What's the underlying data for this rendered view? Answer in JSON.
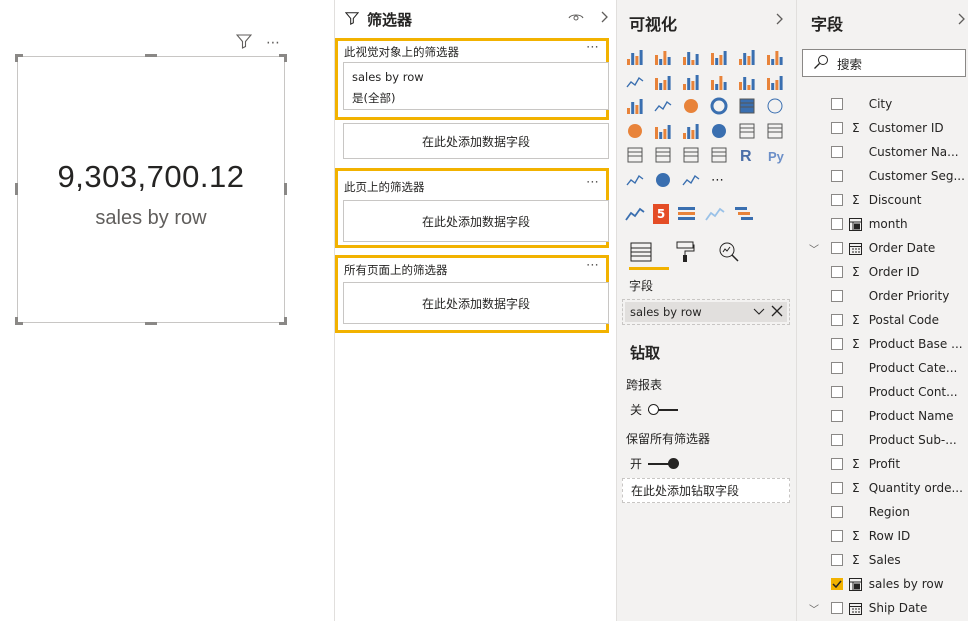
{
  "card": {
    "value": "9,303,700.12",
    "label": "sales by row",
    "more": "⋯"
  },
  "filters": {
    "title": "筛选器",
    "visual_title": "此视觉对象上的筛选器",
    "visual_field": "sales by row",
    "visual_condition": "是(全部)",
    "visual_add": "在此处添加数据字段",
    "page_title": "此页上的筛选器",
    "page_add": "在此处添加数据字段",
    "all_title": "所有页面上的筛选器",
    "all_add": "在此处添加数据字段",
    "more": "⋯"
  },
  "viz": {
    "title": "可视化",
    "fields_label": "字段",
    "field_value": "sales by row",
    "drill_title": "钻取",
    "cross_report": "跨报表",
    "cross_state": "关",
    "keep_filters": "保留所有筛选器",
    "keep_state": "开",
    "drill_add": "在此处添加钻取字段",
    "more_visuals": "⋯",
    "icons": [
      "stacked-bar-icon",
      "stacked-column-icon",
      "clustered-bar-icon",
      "clustered-column-icon",
      "100-bar-icon",
      "100-column-icon",
      "line-chart-icon",
      "area-chart-icon",
      "stacked-area-icon",
      "line-column-icon",
      "line-clustered-icon",
      "ribbon-chart-icon",
      "waterfall-icon",
      "scatter-icon",
      "pie-icon",
      "donut-icon",
      "treemap-icon",
      "map-icon",
      "filled-map-icon",
      "shape-map-icon",
      "funnel-icon",
      "gauge-icon",
      "card-icon",
      "multirow-card-icon",
      "kpi-icon",
      "slicer-icon",
      "table-icon",
      "matrix-icon",
      "r-visual-icon",
      "python-visual-icon",
      "key-influencers-icon",
      "arcgis-icon",
      "decomposition-icon",
      "more-visuals-icon"
    ],
    "custom_icons": [
      "sparkline-icon",
      "html5-icon",
      "bullet-list-icon",
      "wave-icon",
      "gantt-icon"
    ],
    "r_text": "R",
    "py_text": "Py",
    "h5_text": "5",
    "colors": {
      "accent": "#f2b200",
      "bar_orange": "#e8833a",
      "bar_blue": "#3a6fb0"
    }
  },
  "fields": {
    "title": "字段",
    "search_placeholder": "搜索",
    "sigma": "Σ",
    "items": [
      {
        "name": "City",
        "type": "none",
        "checked": false,
        "expand": ""
      },
      {
        "name": "Customer ID",
        "type": "sigma",
        "checked": false,
        "expand": ""
      },
      {
        "name": "Customer Na...",
        "type": "none",
        "checked": false,
        "expand": ""
      },
      {
        "name": "Customer Seg...",
        "type": "none",
        "checked": false,
        "expand": ""
      },
      {
        "name": "Discount",
        "type": "sigma",
        "checked": false,
        "expand": ""
      },
      {
        "name": "month",
        "type": "calc",
        "checked": false,
        "expand": ""
      },
      {
        "name": "Order Date",
        "type": "date",
        "checked": false,
        "expand": "﹀"
      },
      {
        "name": "Order ID",
        "type": "sigma",
        "checked": false,
        "expand": ""
      },
      {
        "name": "Order Priority",
        "type": "none",
        "checked": false,
        "expand": ""
      },
      {
        "name": "Postal Code",
        "type": "sigma",
        "checked": false,
        "expand": ""
      },
      {
        "name": "Product Base ...",
        "type": "sigma",
        "checked": false,
        "expand": ""
      },
      {
        "name": "Product Cate...",
        "type": "none",
        "checked": false,
        "expand": ""
      },
      {
        "name": "Product Cont...",
        "type": "none",
        "checked": false,
        "expand": ""
      },
      {
        "name": "Product Name",
        "type": "none",
        "checked": false,
        "expand": ""
      },
      {
        "name": "Product Sub-...",
        "type": "none",
        "checked": false,
        "expand": ""
      },
      {
        "name": "Profit",
        "type": "sigma",
        "checked": false,
        "expand": ""
      },
      {
        "name": "Quantity orde...",
        "type": "sigma",
        "checked": false,
        "expand": ""
      },
      {
        "name": "Region",
        "type": "none",
        "checked": false,
        "expand": ""
      },
      {
        "name": "Row ID",
        "type": "sigma",
        "checked": false,
        "expand": ""
      },
      {
        "name": "Sales",
        "type": "sigma",
        "checked": false,
        "expand": ""
      },
      {
        "name": "sales by row",
        "type": "calc",
        "checked": true,
        "expand": ""
      },
      {
        "name": "Ship Date",
        "type": "date",
        "checked": false,
        "expand": "﹀"
      }
    ]
  }
}
